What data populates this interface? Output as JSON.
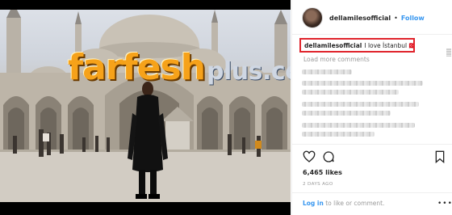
{
  "photo": {
    "watermark_main": "farfesh",
    "watermark_suffix": "plus.com"
  },
  "header": {
    "username": "dellamilesofficial",
    "separator": "•",
    "follow_label": "Follow"
  },
  "caption": {
    "username": "dellamilesofficial",
    "text": "I love İstanbul 🇹🇷"
  },
  "comments": {
    "load_more_label": "Load more comments"
  },
  "actions": {
    "like_icon": "heart-icon",
    "comment_icon": "comment-icon",
    "save_icon": "bookmark-icon"
  },
  "post": {
    "likes": "6,465 likes",
    "timestamp": "2 DAYS AGO"
  },
  "footer": {
    "login_link": "Log in",
    "login_rest": " to like or comment.",
    "more_label": "•••"
  },
  "colors": {
    "link_blue": "#3897f0",
    "highlight_red": "#e0242c",
    "watermark_orange": "#f6a21a"
  }
}
